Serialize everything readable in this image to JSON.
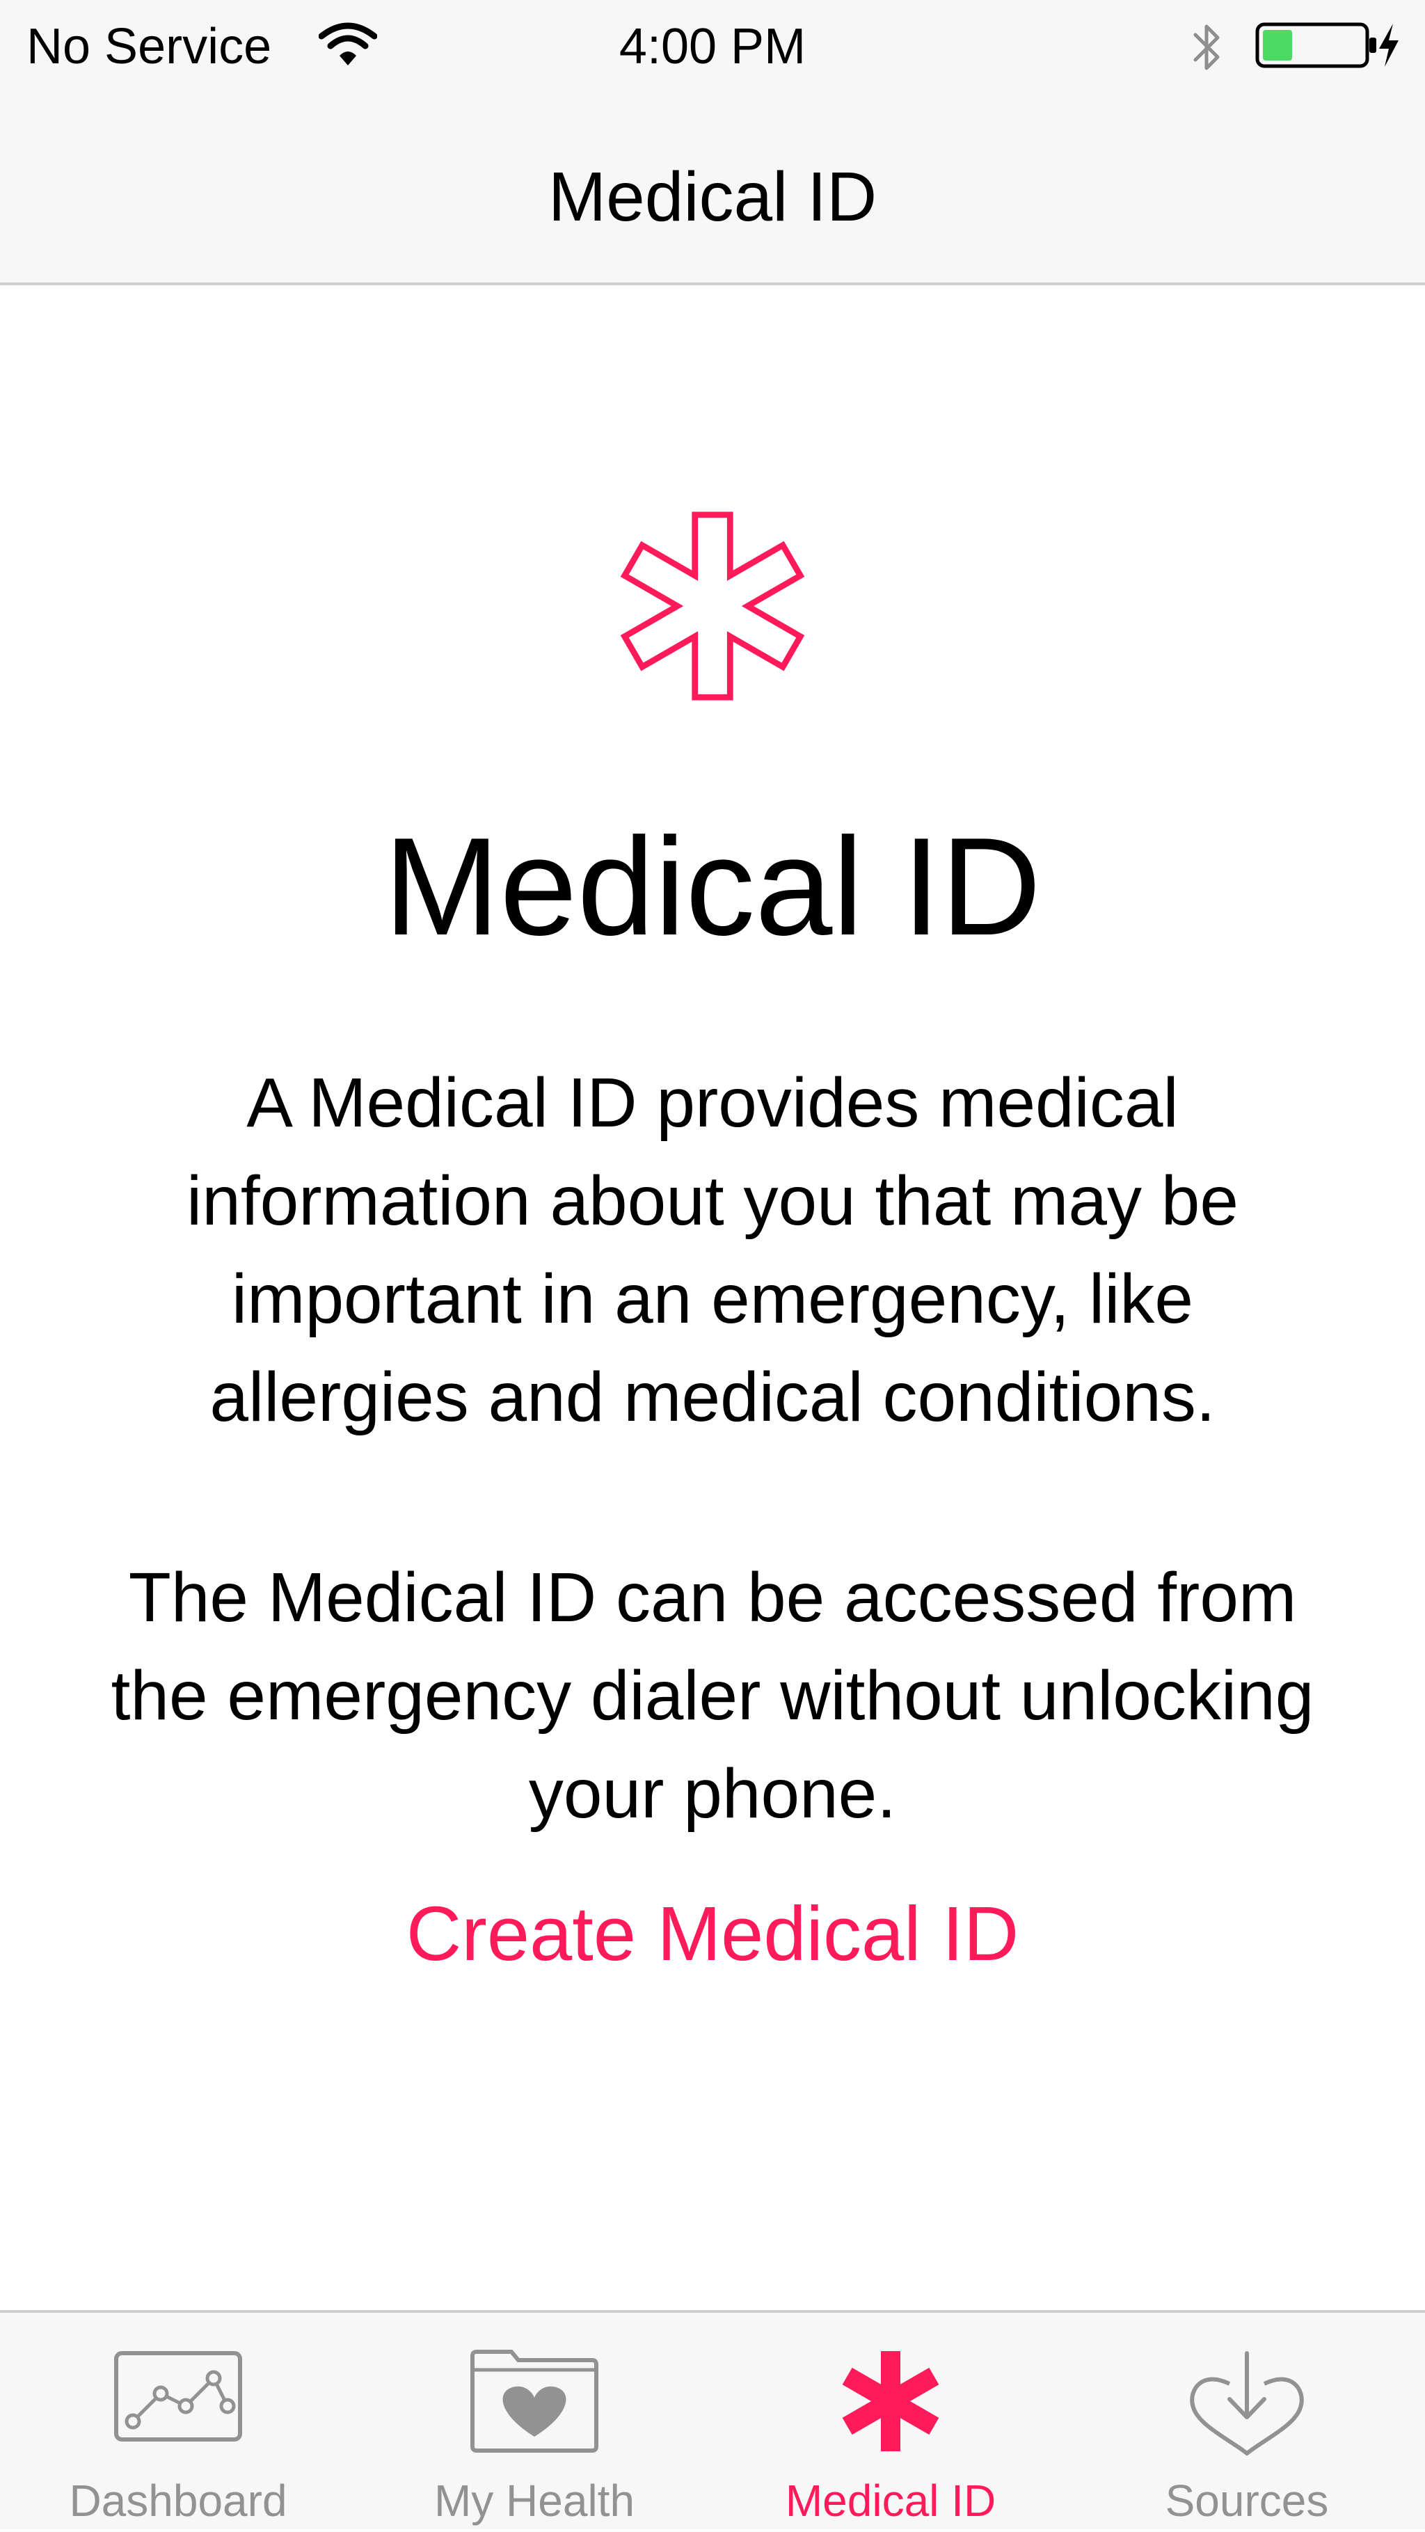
{
  "status_bar": {
    "carrier": "No Service",
    "time": "4:00 PM",
    "battery_color": "#4cd964",
    "icons": [
      "wifi-icon",
      "bluetooth-icon",
      "battery-icon",
      "charging-bolt-icon"
    ]
  },
  "nav": {
    "title": "Medical ID"
  },
  "main": {
    "icon": "medical-star-outline-icon",
    "title": "Medical ID",
    "description_1": "A Medical ID provides medical information about you that may be important in an emergency, like allergies and medical conditions.",
    "description_2": "The Medical ID can be accessed from the emergency dialer without unlocking your phone.",
    "create_link": "Create Medical ID"
  },
  "tab_bar": {
    "active_color": "#ff1a5a",
    "inactive_color": "#929292",
    "tabs": [
      {
        "label": "Dashboard",
        "icon": "dashboard-chart-icon",
        "active": false
      },
      {
        "label": "My Health",
        "icon": "health-folder-icon",
        "active": false
      },
      {
        "label": "Medical ID",
        "icon": "medical-star-icon",
        "active": true
      },
      {
        "label": "Sources",
        "icon": "sources-download-heart-icon",
        "active": false
      }
    ]
  }
}
